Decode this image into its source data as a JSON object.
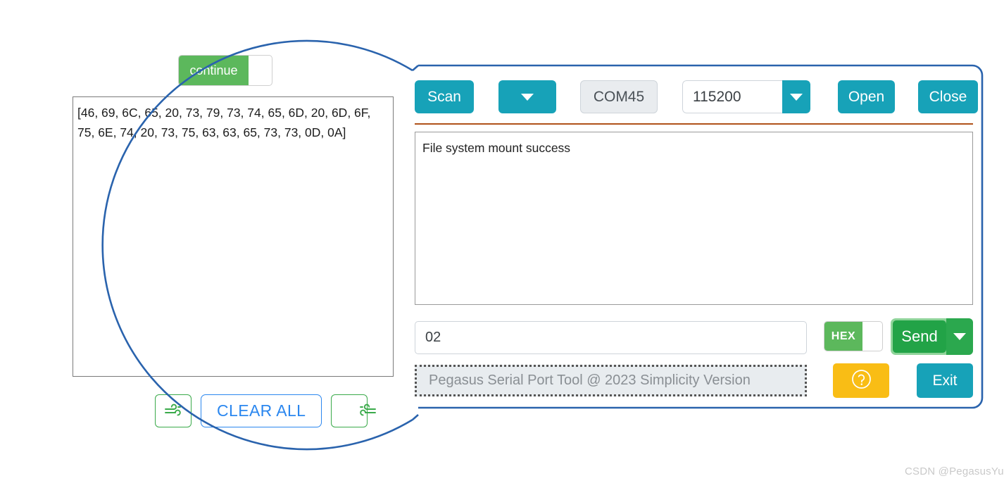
{
  "magnifier": {
    "continue_toggle": {
      "label": "continue",
      "state": "on"
    },
    "hex_dump": "[46, 69, 6C, 65, 20, 73, 79, 73, 74, 65, 6D, 20, 6D, 6F, 75, 6E, 74, 20, 73, 75, 63, 63, 65, 73, 73, 0D, 0A]",
    "buttons": {
      "wind_left": {
        "icon": "wind-icon",
        "label": ""
      },
      "clear_all": {
        "label": "CLEAR ALL"
      },
      "wind_right": {
        "icon": "wind-reverse-icon",
        "label": ""
      }
    }
  },
  "panel": {
    "toolbar": {
      "scan_label": "Scan",
      "port_dropdown_icon": "chevron-down-icon",
      "port_value": "COM45",
      "baud_value": "115200",
      "baud_dropdown_icon": "chevron-down-icon",
      "open_label": "Open",
      "close_label": "Close"
    },
    "receive": {
      "text": "File system mount success"
    },
    "send": {
      "input_value": "02",
      "hex_toggle_label": "HEX",
      "hex_toggle_state": "on",
      "send_label": "Send",
      "send_dropdown_icon": "chevron-down-icon"
    },
    "status_text": "Pegasus Serial Port Tool @ 2023 Simplicity Version",
    "help_icon": "question-circle-icon",
    "exit_label": "Exit"
  },
  "watermark": "CSDN @PegasusYu",
  "colors": {
    "teal": "#17a2b8",
    "green": "#5cb85c",
    "send_green": "#22a347",
    "amber": "#f9bd15",
    "annotation_blue": "#2a63ad",
    "divider_orange": "#b0521a",
    "link_blue": "#2b87ef"
  }
}
